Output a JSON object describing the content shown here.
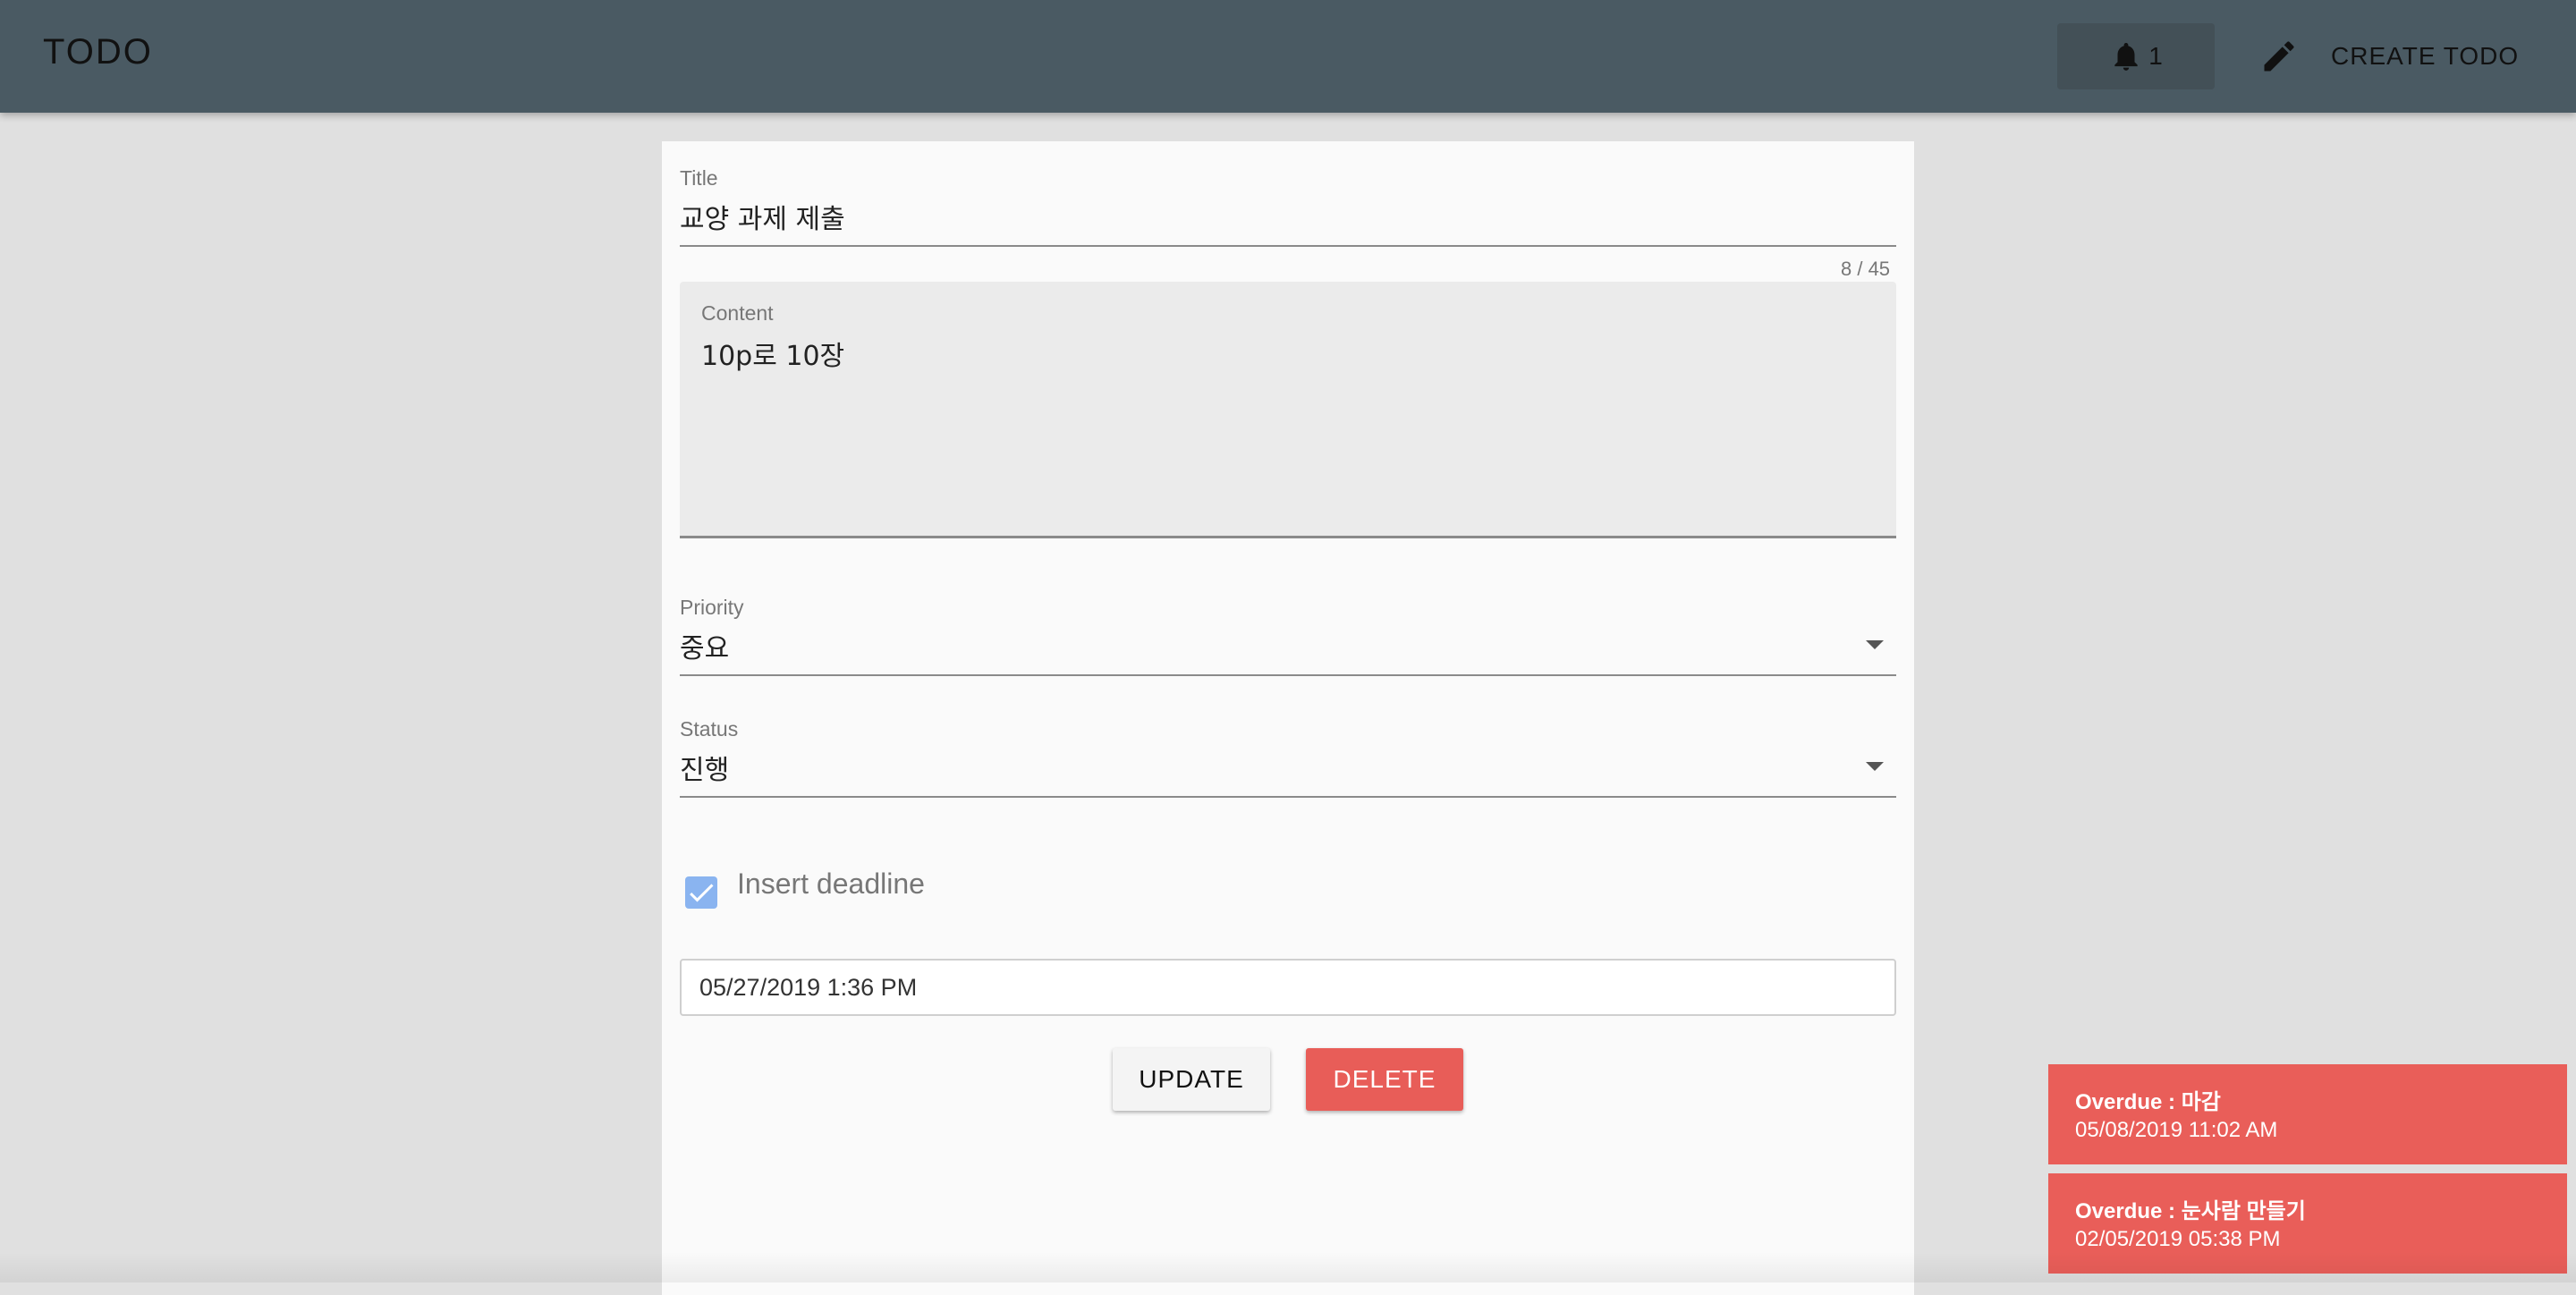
{
  "appbar": {
    "title": "TODO",
    "notification_count": "1",
    "create_label": "CREATE TODO"
  },
  "form": {
    "title": {
      "label": "Title",
      "value": "교양 과제 제출",
      "counter": "8 / 45"
    },
    "content": {
      "label": "Content",
      "value": "10p로 10장"
    },
    "priority": {
      "label": "Priority",
      "value": "중요"
    },
    "status": {
      "label": "Status",
      "value": "진행"
    },
    "deadline_checkbox": {
      "label": "Insert deadline",
      "checked": true
    },
    "deadline_value": "05/27/2019 1:36 PM",
    "update_label": "UPDATE",
    "delete_label": "DELETE"
  },
  "toasts": [
    {
      "title": "Overdue : 마감",
      "time": "05/08/2019 11:02 AM"
    },
    {
      "title": "Overdue : 눈사람 만들기",
      "time": "02/05/2019 05:38 PM"
    }
  ],
  "colors": {
    "appbar": "#4a5a63",
    "background": "#e0e0e0",
    "delete": "#e85d58",
    "toast": "#e95e59",
    "checkbox": "#8ab4f0"
  },
  "icons": [
    "bell-icon",
    "pencil-icon",
    "chevron-down-icon",
    "check-icon"
  ]
}
